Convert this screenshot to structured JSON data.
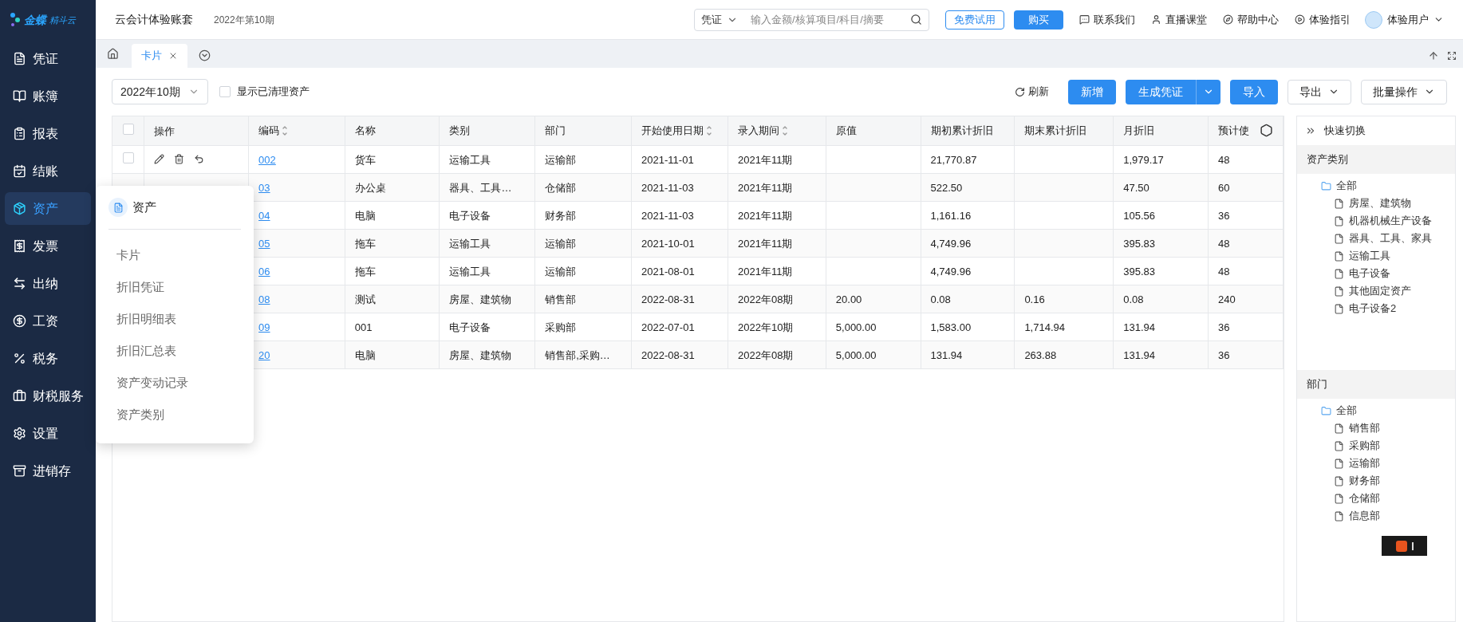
{
  "logo": {
    "brand": "金蝶",
    "product": "精斗云"
  },
  "sidebar": {
    "items": [
      {
        "label": "凭证",
        "selected": false
      },
      {
        "label": "账簿",
        "selected": false
      },
      {
        "label": "报表",
        "selected": false
      },
      {
        "label": "结账",
        "selected": false
      },
      {
        "label": "资产",
        "selected": true
      },
      {
        "label": "发票",
        "selected": false
      },
      {
        "label": "出纳",
        "selected": false
      },
      {
        "label": "工资",
        "selected": false
      },
      {
        "label": "税务",
        "selected": false
      },
      {
        "label": "财税服务",
        "selected": false
      },
      {
        "label": "设置",
        "selected": false
      },
      {
        "label": "进销存",
        "selected": false
      }
    ]
  },
  "header": {
    "account": "云会计体验账套",
    "period": "2022年第10期",
    "search": {
      "scope": "凭证",
      "placeholder": "输入金额/核算项目/科目/摘要"
    },
    "trial_button": "免费试用",
    "buy_button": "购买",
    "links": [
      {
        "kind": "contact",
        "label": "联系我们"
      },
      {
        "kind": "live",
        "label": "直播课堂"
      },
      {
        "kind": "help",
        "label": "帮助中心"
      },
      {
        "kind": "guide",
        "label": "体验指引"
      }
    ],
    "user": "体验用户"
  },
  "tabs": [
    {
      "label": "卡片",
      "selected": true
    }
  ],
  "toolbar": {
    "period": "2022年10期",
    "show_cleared": {
      "label": "显示已清理资产",
      "checked": false
    },
    "refresh": "刷新",
    "buttons": [
      {
        "kind": "primary",
        "label": "新增"
      },
      {
        "kind": "split",
        "label": "生成凭证"
      },
      {
        "kind": "primary",
        "label": "导入"
      },
      {
        "kind": "dropdown",
        "label": "导出"
      },
      {
        "kind": "dropdown",
        "label": "批量操作"
      }
    ]
  },
  "table": {
    "header_checked": false,
    "actions_label": "操作",
    "columns": [
      {
        "label": "编码",
        "sortable": true
      },
      {
        "label": "名称",
        "sortable": false
      },
      {
        "label": "类别",
        "sortable": false
      },
      {
        "label": "部门",
        "sortable": false
      },
      {
        "label": "开始使用日期",
        "sortable": true
      },
      {
        "label": "录入期间",
        "sortable": true
      },
      {
        "label": "原值",
        "sortable": false
      },
      {
        "label": "期初累计折旧",
        "sortable": false
      },
      {
        "label": "期末累计折旧",
        "sortable": false
      },
      {
        "label": "月折旧",
        "sortable": false
      },
      {
        "label": "预计使",
        "sortable": false
      }
    ],
    "rows": [
      {
        "checked": false,
        "cells": [
          "002",
          "货车",
          "运输工具",
          "运输部",
          "2021-11-01",
          "2021年11期",
          "",
          "21,770.87",
          "",
          "1,979.17",
          "48"
        ]
      },
      {
        "cells": [
          "03",
          "办公桌",
          "器具、工具…",
          "仓储部",
          "2021-11-03",
          "2021年11期",
          "",
          "522.50",
          "",
          "47.50",
          "60"
        ]
      },
      {
        "cells": [
          "04",
          "电脑",
          "电子设备",
          "财务部",
          "2021-11-03",
          "2021年11期",
          "",
          "1,161.16",
          "",
          "105.56",
          "36"
        ]
      },
      {
        "cells": [
          "05",
          "拖车",
          "运输工具",
          "运输部",
          "2021-10-01",
          "2021年11期",
          "",
          "4,749.96",
          "",
          "395.83",
          "48"
        ]
      },
      {
        "cells": [
          "06",
          "拖车",
          "运输工具",
          "运输部",
          "2021-08-01",
          "2021年11期",
          "",
          "4,749.96",
          "",
          "395.83",
          "48"
        ]
      },
      {
        "cells": [
          "08",
          "测试",
          "房屋、建筑物",
          "销售部",
          "2022-08-31",
          "2022年08期",
          "20.00",
          "0.08",
          "0.16",
          "0.08",
          "240"
        ]
      },
      {
        "cells": [
          "09",
          "001",
          "电子设备",
          "采购部",
          "2022-07-01",
          "2022年10期",
          "5,000.00",
          "1,583.00",
          "1,714.94",
          "131.94",
          "36"
        ]
      },
      {
        "cells": [
          "20",
          "电脑",
          "房屋、建筑物",
          "销售部,采购…",
          "2022-08-31",
          "2022年08期",
          "5,000.00",
          "131.94",
          "263.88",
          "131.94",
          "36"
        ]
      }
    ]
  },
  "flyout": {
    "title": "资产",
    "items": [
      "卡片",
      "折旧凭证",
      "折旧明细表",
      "折旧汇总表",
      "资产变动记录",
      "资产类别"
    ]
  },
  "quick_panel": {
    "title": "快速切换",
    "sections": [
      {
        "title": "资产类别",
        "tree": {
          "label": "全部",
          "children": [
            {
              "label": "房屋、建筑物"
            },
            {
              "label": "机器机械生产设备"
            },
            {
              "label": "器具、工具、家具"
            },
            {
              "label": "运输工具"
            },
            {
              "label": "电子设备"
            },
            {
              "label": "其他固定资产"
            },
            {
              "label": "电子设备2"
            }
          ]
        }
      },
      {
        "title": "部门",
        "tree": {
          "label": "全部",
          "children": [
            {
              "label": "销售部"
            },
            {
              "label": "采购部"
            },
            {
              "label": "运输部"
            },
            {
              "label": "财务部"
            },
            {
              "label": "仓储部"
            },
            {
              "label": "信息部"
            }
          ]
        }
      }
    ]
  }
}
